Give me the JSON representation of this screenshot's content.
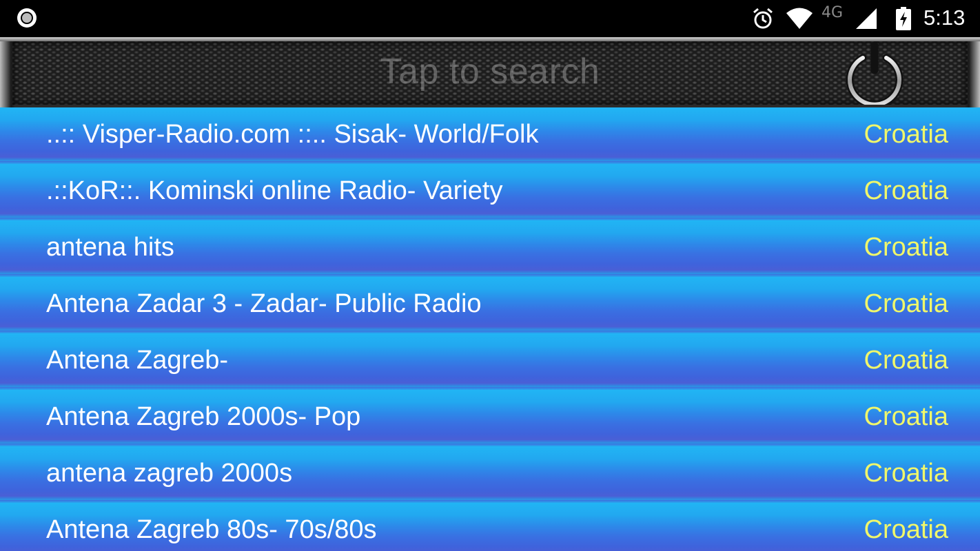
{
  "status_bar": {
    "left_icon": "record-circle-icon",
    "icons": [
      "alarm-icon",
      "wifi-icon",
      "signal-icon",
      "battery-charging-icon"
    ],
    "network": "4G",
    "time": "5:13"
  },
  "search": {
    "placeholder": "Tap to search",
    "power_icon": "power-icon"
  },
  "colors": {
    "row_blue": "#2c8bea",
    "name_text": "#ffffff",
    "country_text": "#f0f76a"
  },
  "stations": [
    {
      "name": "..:: Visper-Radio.com ::.. Sisak- World/Folk",
      "country": "Croatia"
    },
    {
      "name": ".::KoR::.  Kominski online Radio- Variety",
      "country": "Croatia"
    },
    {
      "name": "antena hits",
      "country": "Croatia"
    },
    {
      "name": "Antena Zadar 3 - Zadar- Public Radio",
      "country": "Croatia"
    },
    {
      "name": "Antena Zagreb-",
      "country": "Croatia"
    },
    {
      "name": "Antena Zagreb 2000s- Pop",
      "country": "Croatia"
    },
    {
      "name": "antena zagreb 2000s",
      "country": "Croatia"
    },
    {
      "name": "Antena Zagreb 80s- 70s/80s",
      "country": "Croatia"
    }
  ]
}
